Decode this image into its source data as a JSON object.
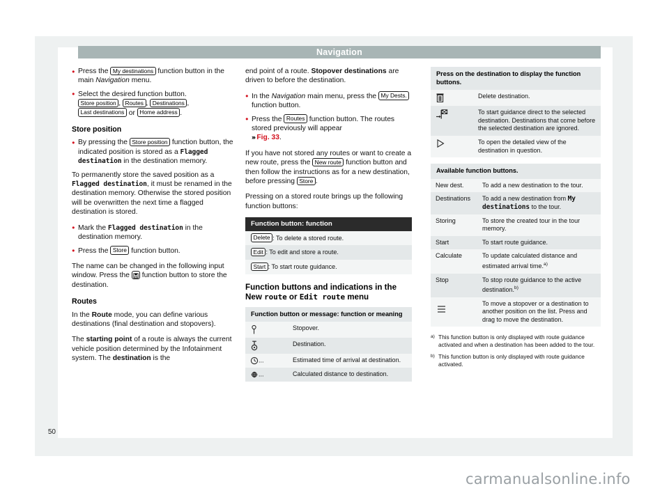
{
  "running_head": "Navigation",
  "page_number": "50",
  "watermark": "carmanualsonline.info",
  "column1": {
    "b1_pre": "Press the ",
    "b1_key": "My destinations",
    "b1_mid": " function button in the main ",
    "b1_italic": "Navigation",
    "b1_post": " menu.",
    "b2_text": "Select the desired function button.",
    "keys_line": [
      "Store position",
      "Routes",
      "Destinations",
      "Last destinations",
      "Home address"
    ],
    "keys_or": "or",
    "heading_store_position": "Store position",
    "sp_b1_pre": "By pressing the ",
    "sp_b1_key": "Store position",
    "sp_b1_mid": " function button, the indicated position is stored as a ",
    "sp_b1_mono": "Flagged destination",
    "sp_b1_post": " in the destination memory.",
    "sp_p2_pre": "To permanently store the saved position as a ",
    "sp_p2_mono": "Flagged destination",
    "sp_p2_post": ", it must be renamed in the destination memory. Otherwise the stored position will be overwritten the next time a flagged destination is stored.",
    "sp_b2_pre": "Mark the ",
    "sp_b2_mono": "Flagged destination",
    "sp_b2_post": " in the destination memory.",
    "sp_b3_pre": "Press the ",
    "sp_b3_key": "Store",
    "sp_b3_post": " function button.",
    "sp_p3_pre": "The name can be changed in the following input window. Press the ",
    "sp_p3_icon": "store-disk-icon",
    "sp_p3_post": " function button to store the destination.",
    "heading_routes": "Routes",
    "r_p1_pre": "In the ",
    "r_p1_b": "Route",
    "r_p1_post": " mode, you can define various destinations (final destination and stopovers).",
    "r_p2_pre": "The ",
    "r_p2_b1": "starting point",
    "r_p2_mid": " of a route is always the current vehicle position determined by the Infotainment system. The ",
    "r_p2_b2": "destination",
    "r_p2_post": " is the"
  },
  "column2": {
    "cont_pre": "end point of a route. ",
    "cont_b": "Stopover destinations",
    "cont_post": " are driven to before the destination.",
    "b1_pre": "In the ",
    "b1_italic": "Navigation",
    "b1_mid": " main menu, press the ",
    "b1_key": "My Dests.",
    "b1_post": " function button.",
    "b2_pre": "Press the ",
    "b2_key": "Routes",
    "b2_mid": " function button. The routes stored previously will appear ",
    "b2_ref": "Fig. 33",
    "b2_post": ".",
    "p3_pre": "If you have not stored any routes or want to create a new route, press the ",
    "p3_key1": "New route",
    "p3_mid": " function button and then follow the instructions as for a new destination, before pressing ",
    "p3_key2": "Store",
    "p3_post": ".",
    "p4": "Pressing on a stored route brings up the following function buttons:",
    "table1": {
      "caption": "Function button: function",
      "rows": [
        {
          "key": "Delete",
          "text": ": To delete a stored route."
        },
        {
          "key": "Edit",
          "text": ": To edit and store a route."
        },
        {
          "key": "Start",
          "text": ": To start route guidance."
        }
      ]
    },
    "section_heading_1": "Function buttons and indications in the New",
    "section_heading_mono1": "route",
    "section_heading_2": " or ",
    "section_heading_mono2": "Edit route",
    "section_heading_3": " menu",
    "table2": {
      "caption": "Function button or message: function or meaning",
      "rows": [
        {
          "icon": "stopover-pin-icon",
          "text": "Stopover."
        },
        {
          "icon": "destination-pin-icon",
          "text": "Destination."
        },
        {
          "icon": "clock-icon",
          "suffix": "...",
          "text": "Estimated time of arrival at destination."
        },
        {
          "icon": "globe-crosshair-icon",
          "suffix": "...",
          "text": "Calculated distance to destination."
        }
      ]
    }
  },
  "column3": {
    "table1": {
      "caption": "Press on the destination to display the function buttons.",
      "rows": [
        {
          "icon": "trash-icon",
          "text": "Delete destination."
        },
        {
          "icon": "arrow-to-flag-icon",
          "text": "To start guidance direct to the selected destination. Destinations that come before the selected destination are ignored."
        },
        {
          "icon": "play-triangle-icon",
          "text": "To open the detailed view of the destination in question."
        }
      ]
    },
    "table2": {
      "caption": "Available function buttons.",
      "rows": [
        {
          "label": "New dest.",
          "text": "To add a new destination to the tour."
        },
        {
          "label": "Destinations",
          "text_pre": "To add a new destination from ",
          "mono": "My destinations",
          "text_post": " to the tour."
        },
        {
          "label": "Storing",
          "text": "To store the created tour in the tour memory."
        },
        {
          "label": "Start",
          "text": "To start route guidance."
        },
        {
          "label": "Calculate",
          "text": "To update calculated distance and estimated arrival time.",
          "footnote": "a)"
        },
        {
          "label": "Stop",
          "text": "To stop route guidance to the active destination.",
          "footnote": "b)"
        },
        {
          "icon": "list-reorder-icon",
          "text": "To move a stopover or a destination to another position on the list. Press and drag to move the destination."
        }
      ]
    },
    "footnotes": [
      {
        "mark": "a)",
        "text": "This function button is only displayed with route guidance activated and when a destination has been added to the tour."
      },
      {
        "mark": "b)",
        "text": "This function button is only displayed with route guidance activated."
      }
    ]
  },
  "colors": {
    "accent_red": "#d4121f",
    "running_head_bg": "#a8b5b5",
    "dark_caption_bg": "#2b2b2b",
    "row_a": "#e4e8e9",
    "row_b": "#f3f5f5",
    "frame_bg": "#eef1f1"
  }
}
